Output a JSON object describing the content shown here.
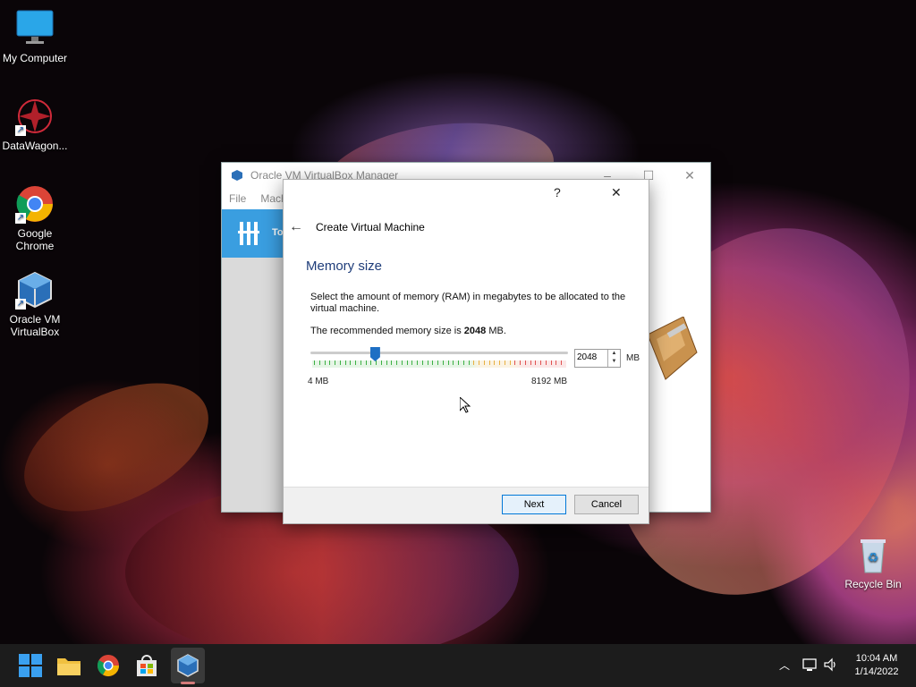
{
  "desktop": {
    "icons": [
      {
        "label": "My Computer",
        "icon": "monitor-icon"
      },
      {
        "label": "DataWagon...",
        "icon": "datawagon-icon"
      },
      {
        "label": "Google Chrome",
        "icon": "chrome-icon"
      },
      {
        "label": "Oracle VM VirtualBox",
        "icon": "virtualbox-icon"
      },
      {
        "label": "Recycle Bin",
        "icon": "recycle-bin-icon"
      }
    ]
  },
  "manager": {
    "title": "Oracle VM VirtualBox Manager",
    "menu": [
      "File",
      "Mach"
    ],
    "tools_label": "To"
  },
  "dialog": {
    "help": "?",
    "close": "✕",
    "title": "Create Virtual Machine",
    "heading": "Memory size",
    "description": "Select the amount of memory (RAM) in megabytes to be allocated to the virtual machine.",
    "recommended_prefix": "The recommended memory size is ",
    "recommended_value": "2048",
    "recommended_suffix": " MB.",
    "slider": {
      "min_label": "4 MB",
      "max_label": "8192 MB",
      "min": 4,
      "max": 8192,
      "value": 2048
    },
    "memory_value": "2048",
    "unit": "MB",
    "next_label": "Next",
    "cancel_label": "Cancel"
  },
  "taskbar": {
    "apps": [
      "start-icon",
      "file-explorer-icon",
      "chrome-icon",
      "store-icon",
      "virtualbox-icon"
    ],
    "time": "10:04 AM",
    "date": "1/14/2022"
  },
  "colors": {
    "accent": "#1e6fc4",
    "heading": "#1f3d7a",
    "tools_blue": "#3a9ee0"
  }
}
